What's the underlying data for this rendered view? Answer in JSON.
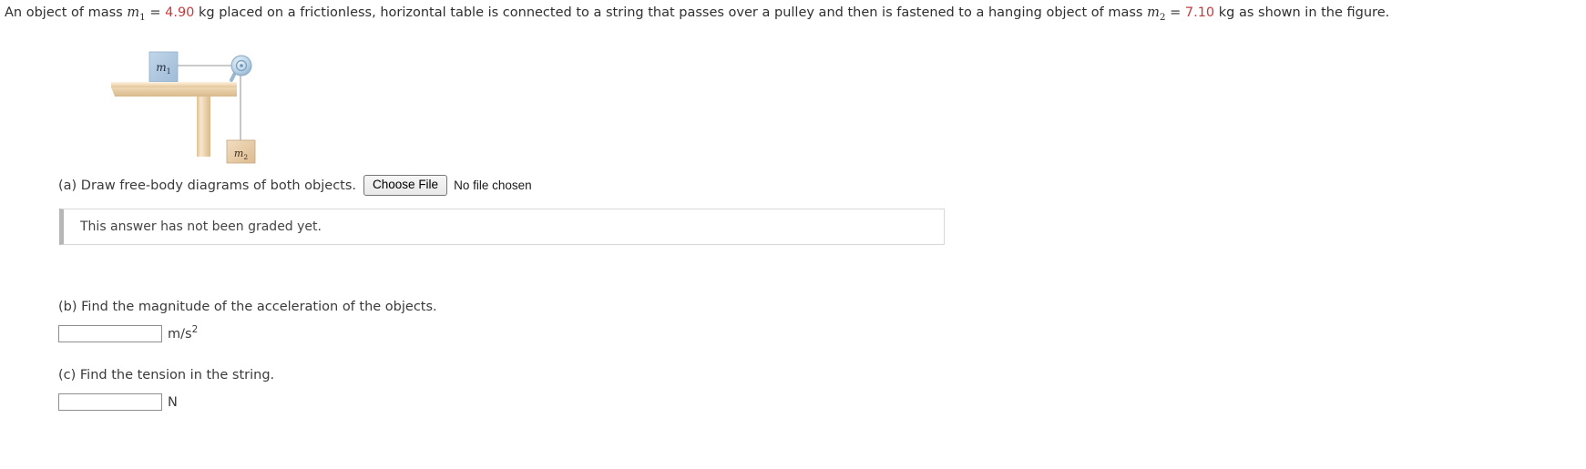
{
  "problem": {
    "text_part_1": "An object of mass ",
    "m1_symbol": "m",
    "m1_sub": "1",
    "eq1": " = ",
    "m1_value": "4.90",
    "text_part_2": " kg placed on a frictionless, horizontal table is connected to a string that passes over a pulley and then is fastened to a hanging object of mass ",
    "m2_symbol": "m",
    "m2_sub": "2",
    "eq2": " = ",
    "m2_value": "7.10",
    "text_part_3": " kg as shown in the figure.",
    "value_color": "#c33c3c"
  },
  "figure": {
    "block1_label": "m",
    "block1_sub": "1",
    "block2_label": "m",
    "block2_sub": "2",
    "block1_color": "#aac4de",
    "block2_color": "#e8cfae",
    "table_color": "#f0dcbe",
    "pulley_color": "#bcd3e6"
  },
  "parts": {
    "a": {
      "prompt": "(a) Draw free-body diagrams of both objects.",
      "choose_file_label": "Choose File",
      "no_file_text": "No file chosen",
      "graded_notice": "This answer has not been graded yet."
    },
    "b": {
      "prompt": "(b) Find the magnitude of the acceleration of the objects.",
      "answer_value": "",
      "unit_main": "m/s",
      "unit_sup": "2"
    },
    "c": {
      "prompt": "(c) Find the tension in the string.",
      "answer_value": "",
      "unit_main": "N",
      "unit_sup": ""
    }
  }
}
